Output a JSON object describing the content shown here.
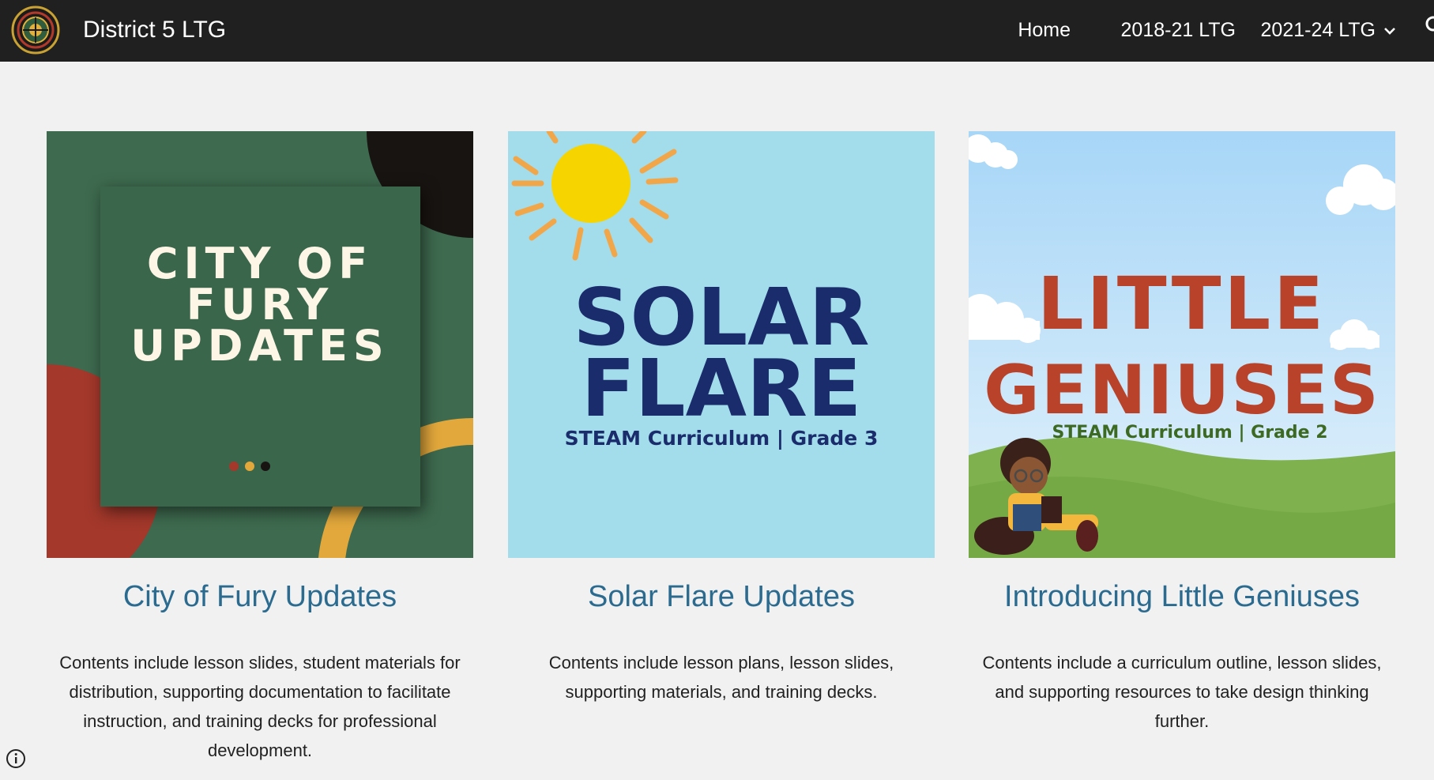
{
  "site": {
    "title": "District 5 LTG",
    "logo_icon": "district-5-ltg-seal-logo"
  },
  "nav": {
    "items": [
      {
        "label": "Home"
      },
      {
        "label": "2018-21 LTG"
      },
      {
        "label": "2021-24 LTG",
        "has_dropdown": true
      }
    ],
    "search_icon": "search-icon"
  },
  "cards": [
    {
      "title": "City of Fury Updates",
      "description": "Contents include lesson slides, student materials for distribution, supporting documentation to facilitate instruction, and training decks for professional development.",
      "image_text": [
        "CITY OF",
        "FURY",
        "UPDATES"
      ],
      "colors": {
        "background": "#3e6a4f",
        "red": "#a3382b",
        "gold": "#e3a83c",
        "black": "#181411"
      }
    },
    {
      "title": "Solar Flare Updates",
      "description": "Contents include lesson plans, lesson slides, supporting materials, and training decks.",
      "image_text": [
        "SOLAR",
        "FLARE"
      ],
      "image_subtitle": "STEAM Curriculum | Grade 3",
      "colors": {
        "background": "#a3ddeb",
        "text": "#1a2c6b",
        "sun": "#f6d400",
        "rays": "#f2a64a"
      }
    },
    {
      "title": "Introducing Little Geniuses",
      "description": "Contents include a curriculum outline, lesson slides, and supporting resources to take design thinking further.",
      "image_text": [
        "LITTLE",
        "GENIUSES"
      ],
      "image_subtitle": "STEAM Curriculum | Grade 2",
      "colors": {
        "sky": "#bfe3fa",
        "text": "#b8432a",
        "grass": "#7fb24e",
        "subtitle": "#3d6a23"
      }
    }
  ],
  "footer": {
    "info_icon": "info-icon"
  },
  "theme": {
    "header_bg": "#202020",
    "page_bg": "#f1f1f1",
    "link": "#2b6b8f"
  }
}
